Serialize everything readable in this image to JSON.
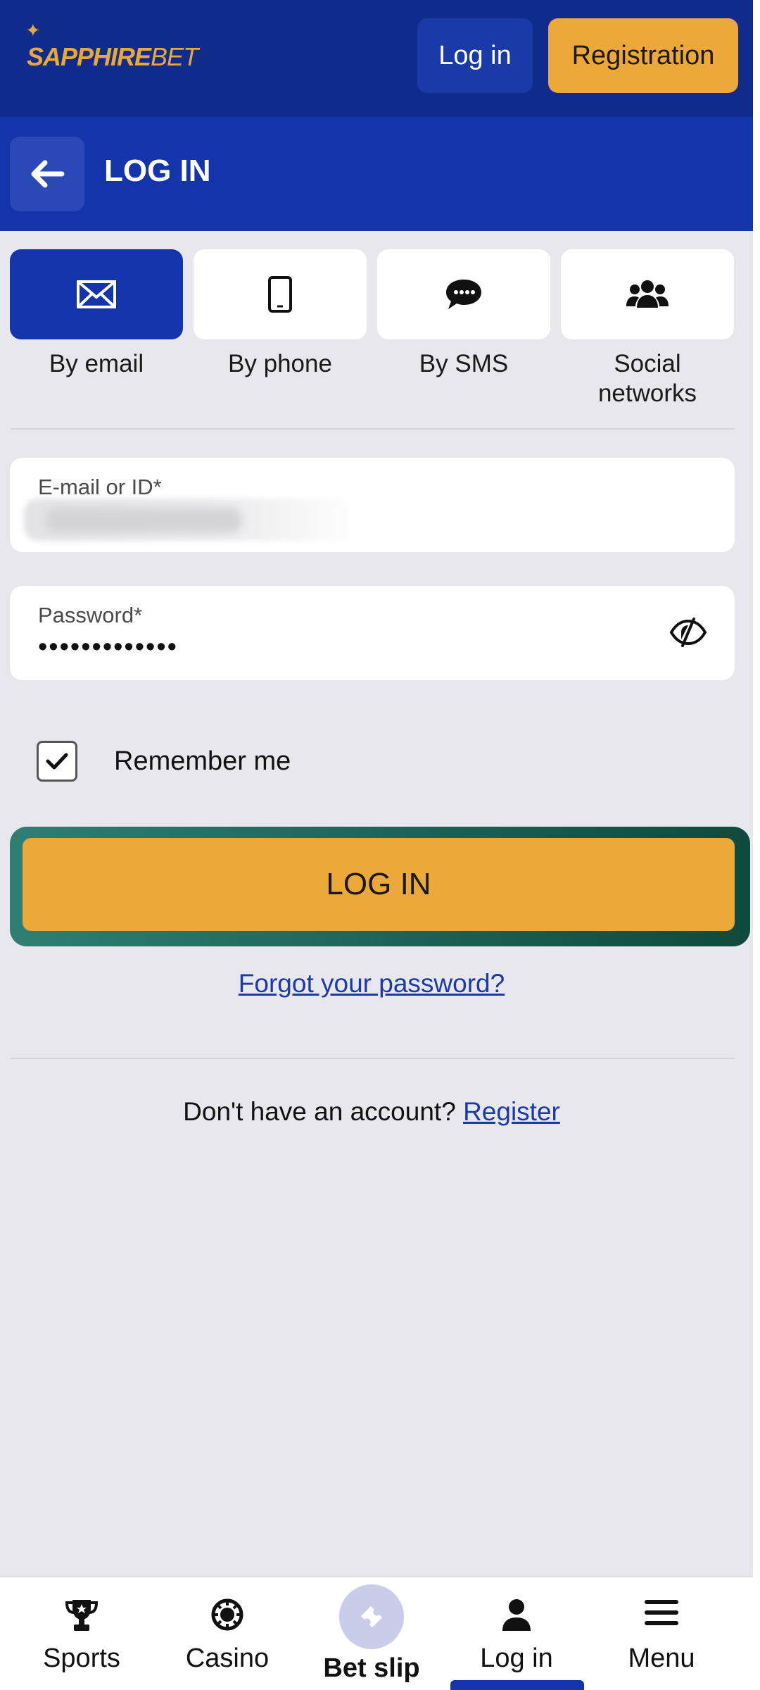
{
  "header": {
    "logo_part1": "SAPPHIRE",
    "logo_part2": "BET",
    "login_label": "Log in",
    "register_label": "Registration"
  },
  "title_bar": {
    "title": "LOG IN"
  },
  "tabs": [
    {
      "label": "By email",
      "icon": "envelope-icon",
      "active": true
    },
    {
      "label": "By phone",
      "icon": "phone-icon",
      "active": false
    },
    {
      "label": "By SMS",
      "icon": "chat-bubble-icon",
      "active": false
    },
    {
      "label": "Social networks",
      "icon": "users-icon",
      "active": false
    }
  ],
  "form": {
    "email_label": "E-mail or ID*",
    "password_label": "Password*",
    "password_value": "•••••••••••••",
    "remember_label": "Remember me",
    "remember_checked": true,
    "submit_label": "LOG IN",
    "forgot_label": "Forgot your password?",
    "no_account_text": "Don't have an account?",
    "register_link": "Register"
  },
  "bottom_nav": [
    {
      "label": "Sports",
      "icon": "trophy-icon"
    },
    {
      "label": "Casino",
      "icon": "casino-chip-icon"
    },
    {
      "label": "Bet slip",
      "icon": "ticket-icon"
    },
    {
      "label": "Log in",
      "icon": "user-icon",
      "active": true
    },
    {
      "label": "Menu",
      "icon": "hamburger-menu-icon"
    }
  ],
  "colors": {
    "header_bg": "#0f2b8c",
    "title_bar_bg": "#1334aa",
    "accent": "#eca93a",
    "page_bg": "#e8e7ee",
    "link": "#1a3aa8"
  }
}
